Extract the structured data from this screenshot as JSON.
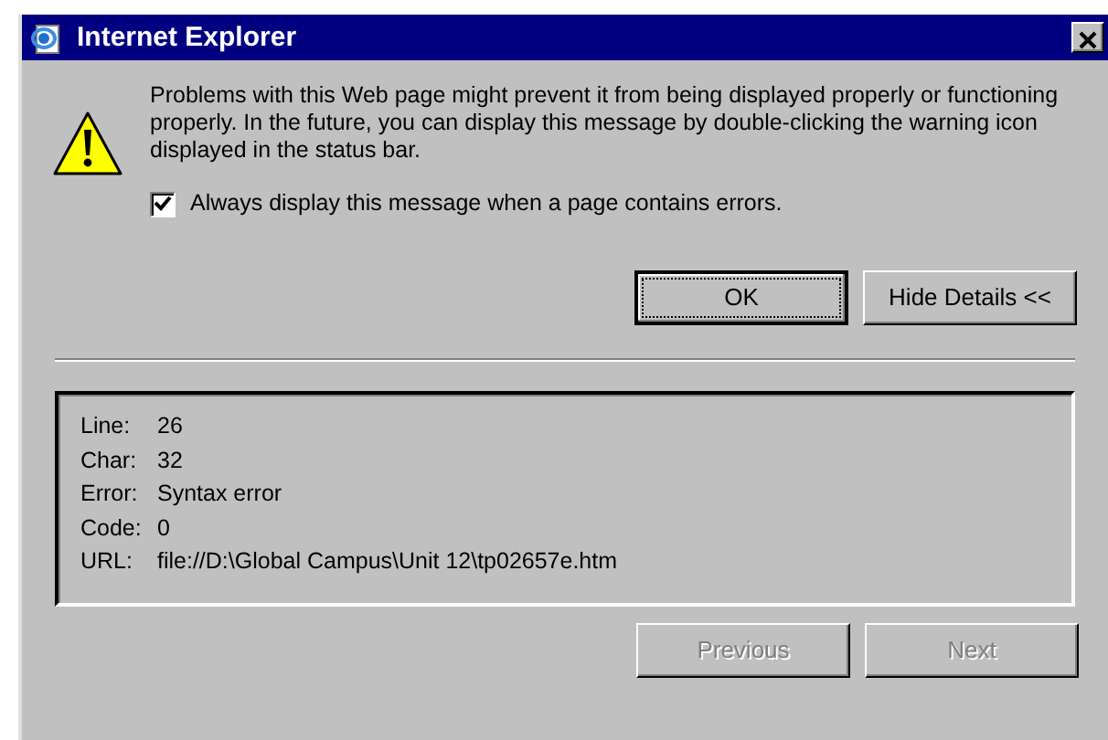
{
  "window": {
    "title": "Internet Explorer"
  },
  "message": "Problems with this Web page might prevent it from being displayed properly or functioning properly. In the future, you can display this message by double-clicking the warning icon displayed in the status bar.",
  "always_display": {
    "label": "Always display this message when a page contains errors.",
    "checked": true
  },
  "buttons": [
    {
      "label": "OK",
      "disabled": false,
      "default": true
    },
    {
      "label": "Hide Details <<",
      "disabled": false,
      "default": false
    }
  ],
  "details": [
    {
      "label": "Line:",
      "value": "26"
    },
    {
      "label": "Char:",
      "value": "32"
    },
    {
      "label": "Error:",
      "value": "Syntax error"
    },
    {
      "label": "Code:",
      "value": "0"
    },
    {
      "label": "URL:",
      "value": "file://D:\\Global Campus\\Unit 12\\tp02657e.htm"
    }
  ],
  "nav_buttons": [
    {
      "label": "Previous",
      "disabled": true
    },
    {
      "label": "Next",
      "disabled": true
    }
  ]
}
